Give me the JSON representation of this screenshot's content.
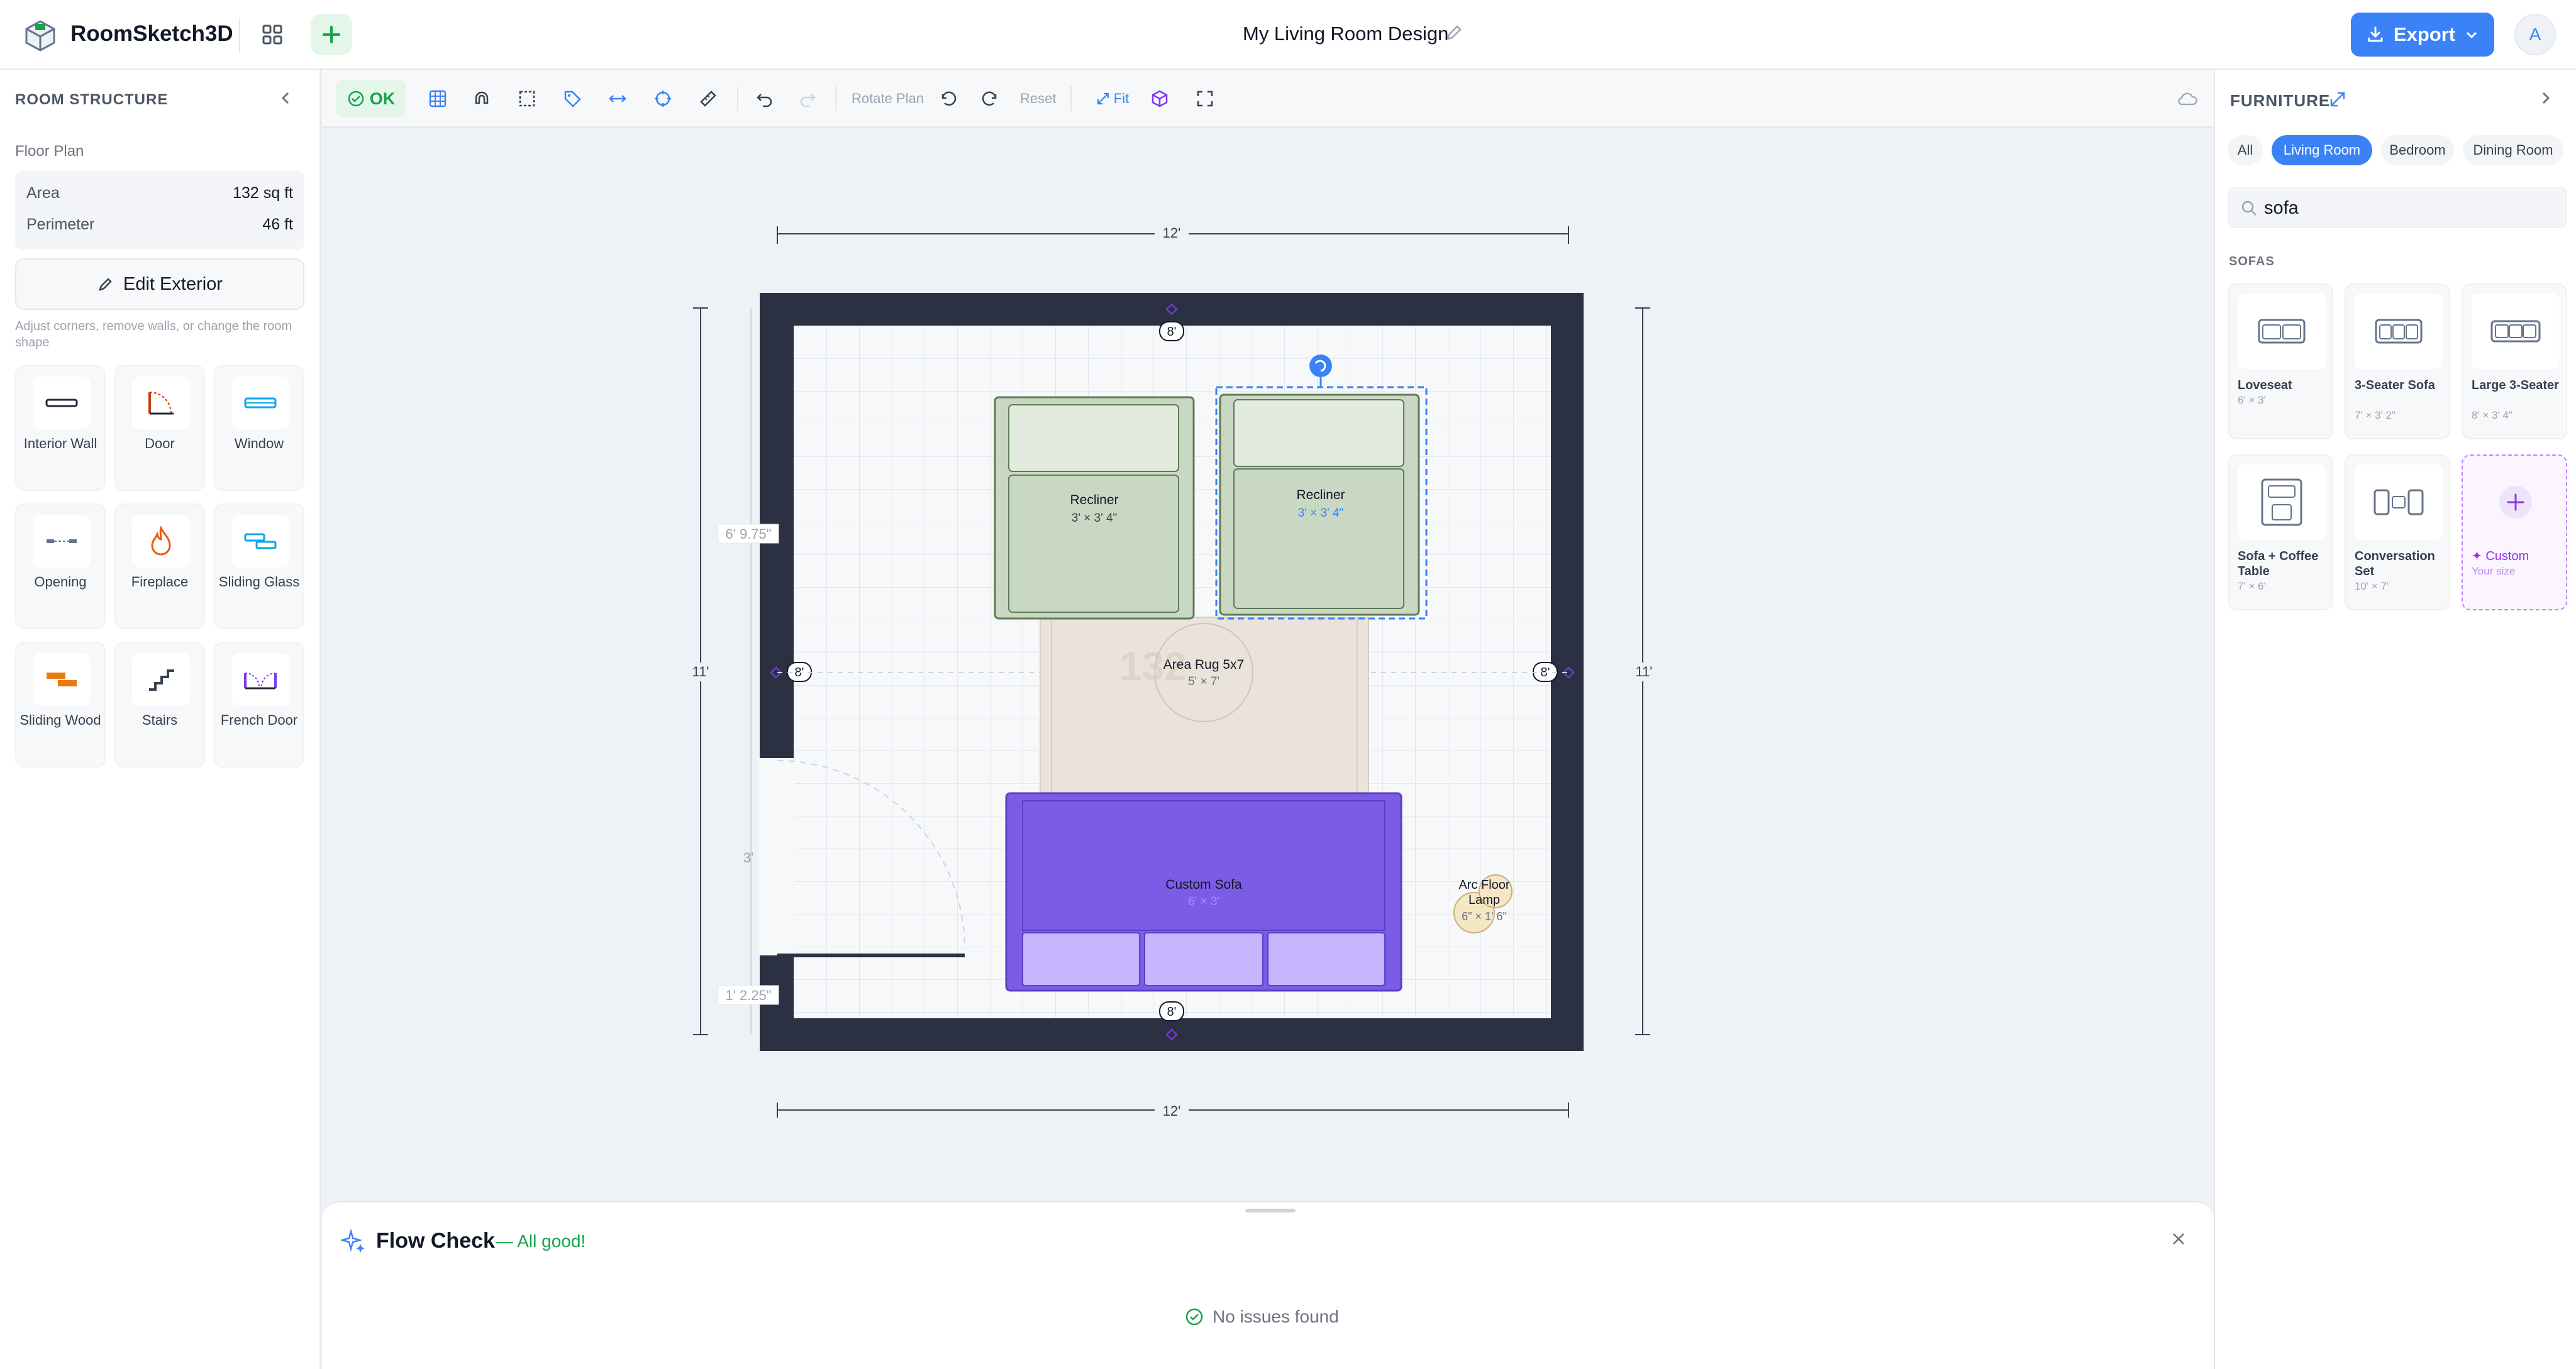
{
  "app": {
    "title": "RoomSketch3D",
    "doc_title": "My Living Room Design",
    "export_label": "Export",
    "avatar_initial": "A"
  },
  "left": {
    "section_title": "ROOM STRUCTURE",
    "floor_plan_title": "Floor Plan",
    "area_label": "Area",
    "area_value": "132 sq ft",
    "perimeter_label": "Perimeter",
    "perimeter_value": "46 ft",
    "edit_exterior": "Edit Exterior",
    "hint": "Adjust corners, remove walls, or change the room shape",
    "tools": [
      "Interior Wall",
      "Door",
      "Window",
      "Opening",
      "Fireplace",
      "Sliding Glass",
      "Sliding Wood",
      "Stairs",
      "French Door"
    ]
  },
  "toolbar": {
    "ok_label": "OK",
    "rotate_label": "Rotate Plan",
    "reset_label": "Reset",
    "fit_label": "Fit"
  },
  "plan": {
    "dims": {
      "top": "12'",
      "bottom": "12'",
      "left": "11'",
      "right": "11'",
      "wall_top": "8'",
      "wall_bottom": "8'",
      "wall_left": "8'",
      "wall_right": "8'",
      "seg1": "6' 9.75\"",
      "seg2": "3'",
      "seg3": "1' 2.25\""
    },
    "area_watermark": "132",
    "items": {
      "recliner1_name": "Recliner",
      "recliner1_dim": "3' × 3' 4\"",
      "recliner2_name": "Recliner",
      "recliner2_dim": "3' × 3' 4\"",
      "rug_name": "Area Rug 5x7",
      "rug_dim": "5' × 7'",
      "sofa_name": "Custom Sofa",
      "sofa_dim": "6' × 3'",
      "lamp_name1": "Arc Floor",
      "lamp_name2": "Lamp",
      "lamp_dim": "6\" × 1' 6\""
    }
  },
  "right": {
    "title": "FURNITURE",
    "chips": [
      "All",
      "Living Room",
      "Bedroom",
      "Dining Room"
    ],
    "active_chip": "Living Room",
    "search_value": "sofa",
    "category": "SOFAS",
    "cards": [
      {
        "name": "Loveseat",
        "dims": "6' × 3'"
      },
      {
        "name": "3-Seater Sofa",
        "dims": "7' × 3' 2\""
      },
      {
        "name": "Large 3-Seater",
        "dims": "8' × 3' 4\""
      },
      {
        "name": "Sofa + Coffee Table",
        "dims": "7' × 6'"
      },
      {
        "name": "Conversation Set",
        "dims": "10' × 7'"
      },
      {
        "name": "Custom",
        "dims": "Your size"
      }
    ]
  },
  "flow": {
    "title": "Flow Check",
    "status": "— All good!",
    "empty": "No issues found"
  },
  "colors": {
    "accent": "#3b82f6",
    "wall": "#2b3142",
    "recliner": "#c9d8c3",
    "sofa": "#7c5ce6",
    "rug": "#e9e3da",
    "ok": "#16a34a"
  }
}
